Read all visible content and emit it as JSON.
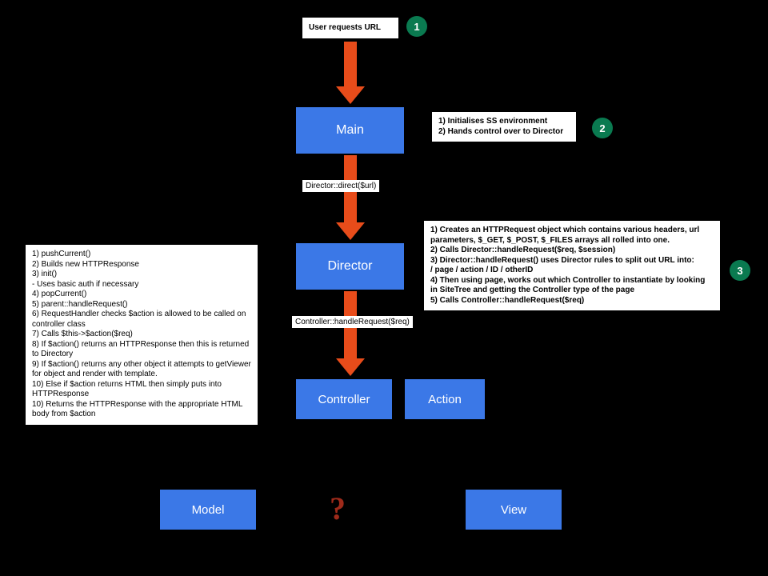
{
  "start": {
    "text": "User requests URL"
  },
  "badges": {
    "b1": "1",
    "b2": "2",
    "b3": "3"
  },
  "blocks": {
    "main": "Main",
    "director": "Director",
    "controller": "Controller",
    "action": "Action",
    "model": "Model",
    "view": "View"
  },
  "labels": {
    "direct": "Director::direct($url)",
    "handle": "Controller::handleRequest($req)"
  },
  "notes": {
    "main": "1) Initialises SS environment\n2) Hands control over to Director",
    "director": "1) Creates an HTTPRequest object which contains various headers, url parameters, $_GET, $_POST, $_FILES arrays all rolled into one.\n2) Calls Director::handleRequest($req, $session)\n3) Director::handleRequest() uses Director rules to split out URL into:\n/ page / action / ID / otherID\n4) Then using page, works out which Controller to instantiate by looking in SiteTree and getting the Controller type of the page\n5) Calls Controller::handleRequest($req)",
    "controller": "1) pushCurrent()\n2) Builds new HTTPResponse\n3) init()\n- Uses basic auth if necessary\n4) popCurrent()\n5) parent::handleRequest()\n6) RequestHandler checks $action is allowed to be called on controller class\n7) Calls $this->$action($req)\n8) If $action() returns an HTTPResponse then this is returned to Directory\n9) If $action() returns any other object it attempts to getViewer for object and render with template.\n10) Else if $action returns HTML then simply puts into HTTPResponse\n10) Returns the HTTPResponse with the appropriate HTML body from $action"
  },
  "qmark": "?"
}
